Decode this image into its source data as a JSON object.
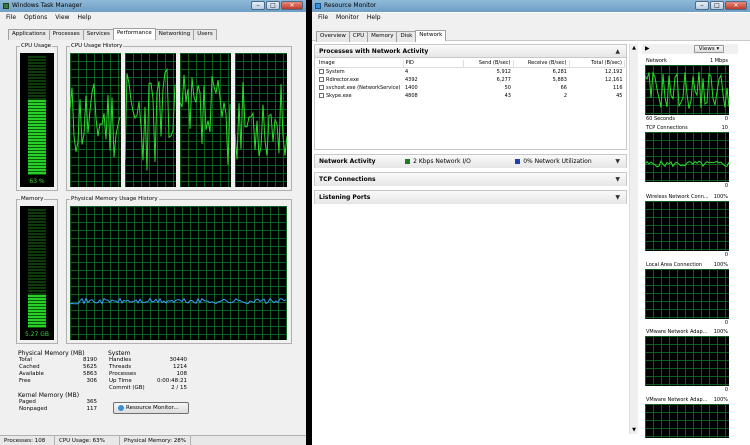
{
  "task_manager": {
    "title": "Windows Task Manager",
    "menu": [
      "File",
      "Options",
      "View",
      "Help"
    ],
    "tabs": [
      "Applications",
      "Processes",
      "Services",
      "Performance",
      "Networking",
      "Users"
    ],
    "active_tab": "Performance",
    "cpu_usage_label": "CPU Usage",
    "cpu_usage_value": "63 %",
    "cpu_usage_fraction": 0.63,
    "cpu_history_label": "CPU Usage History",
    "memory_label": "Memory",
    "memory_value": "5.27 GB",
    "memory_fraction": 0.28,
    "memory_history_label": "Physical Memory Usage History",
    "physical_memory": {
      "title": "Physical Memory (MB)",
      "rows": [
        {
          "label": "Total",
          "value": "8190"
        },
        {
          "label": "Cached",
          "value": "5625"
        },
        {
          "label": "Available",
          "value": "5863"
        },
        {
          "label": "Free",
          "value": "306"
        }
      ]
    },
    "system": {
      "title": "System",
      "rows": [
        {
          "label": "Handles",
          "value": "30440"
        },
        {
          "label": "Threads",
          "value": "1214"
        },
        {
          "label": "Processes",
          "value": "108"
        },
        {
          "label": "Up Time",
          "value": "0:00:48:21"
        },
        {
          "label": "Commit (GB)",
          "value": "2 / 15"
        }
      ]
    },
    "kernel_memory": {
      "title": "Kernel Memory (MB)",
      "rows": [
        {
          "label": "Paged",
          "value": "365"
        },
        {
          "label": "Nonpaged",
          "value": "117"
        }
      ]
    },
    "resource_monitor_button": "Resource Monitor...",
    "status": {
      "processes": "Processes: 108",
      "cpu": "CPU Usage: 63%",
      "memory": "Physical Memory: 28%"
    }
  },
  "resource_monitor": {
    "title": "Resource Monitor",
    "menu": [
      "File",
      "Monitor",
      "Help"
    ],
    "tabs": [
      "Overview",
      "CPU",
      "Memory",
      "Disk",
      "Network"
    ],
    "active_tab": "Network",
    "processes_section": {
      "title": "Processes with Network Activity",
      "columns": [
        "Image",
        "PID",
        "Send (B/sec)",
        "Receive (B/sec)",
        "Total (B/sec)"
      ],
      "rows": [
        {
          "image": "System",
          "pid": "4",
          "send": "5,912",
          "receive": "6,281",
          "total": "12,192"
        },
        {
          "image": "Rdirector.exe",
          "pid": "4392",
          "send": "6,277",
          "receive": "5,883",
          "total": "12,161"
        },
        {
          "image": "svchost.exe (NetworkService)",
          "pid": "1400",
          "send": "50",
          "receive": "66",
          "total": "116"
        },
        {
          "image": "Skype.exe",
          "pid": "4808",
          "send": "43",
          "receive": "2",
          "total": "45"
        }
      ]
    },
    "network_activity": {
      "title": "Network Activity",
      "io_label": "2 Kbps Network I/O",
      "util_label": "0% Network Utilization",
      "io_color": "#1e7d1e",
      "util_color": "#1f3fb5"
    },
    "tcp_section": "TCP Connections",
    "listening_section": "Listening Ports",
    "views_label": "Views",
    "graphs": [
      {
        "name": "Network",
        "top_right": "1 Mbps",
        "bottom_left": "60 Seconds",
        "bottom_right": "0"
      },
      {
        "name": "TCP Connections",
        "top_right": "10",
        "bottom_left": "",
        "bottom_right": "0"
      },
      {
        "name": "Wireless Network Conn...",
        "top_right": "100%",
        "bottom_left": "",
        "bottom_right": "0"
      },
      {
        "name": "Local Area Connection",
        "top_right": "100%",
        "bottom_left": "",
        "bottom_right": "0"
      },
      {
        "name": "VMware Network Adap...",
        "top_right": "100%",
        "bottom_left": "",
        "bottom_right": "0"
      },
      {
        "name": "VMware Network Adap...",
        "top_right": "100%",
        "bottom_left": "",
        "bottom_right": "0"
      }
    ]
  }
}
